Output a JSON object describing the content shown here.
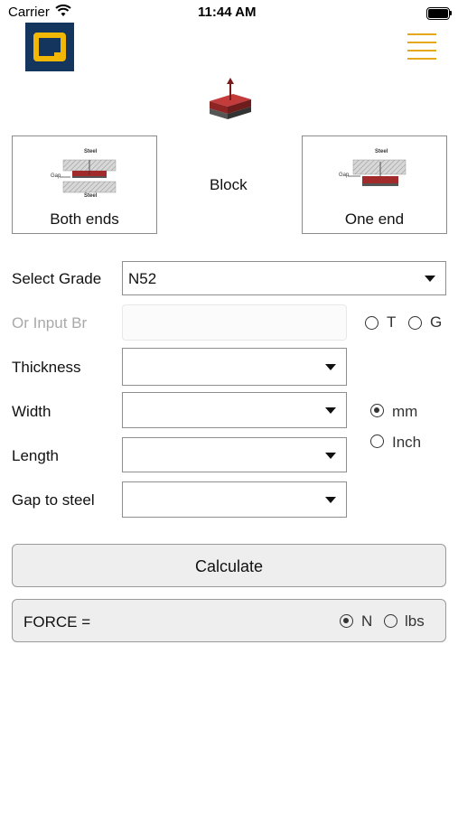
{
  "status_bar": {
    "carrier": "Carrier",
    "time": "11:44 AM"
  },
  "colors": {
    "accent": "#e5a81b",
    "logo_bg": "#14355e",
    "logo_ring": "#f2b705",
    "magnet_red": "#9b2a2a"
  },
  "shape": {
    "name": "Block",
    "icon": "block-magnet-icon"
  },
  "mounting": {
    "both": {
      "label": "Both ends",
      "top_tag": "Steel",
      "bottom_tag": "Steel",
      "gap_tag": "Gap"
    },
    "one": {
      "label": "One end",
      "top_tag": "Steel",
      "gap_tag": "Gap"
    }
  },
  "form": {
    "grade_label": "Select Grade",
    "grade_value": "N52",
    "br_label": "Or Input Br",
    "br_units": [
      "T",
      "G"
    ],
    "thickness_label": "Thickness",
    "width_label": "Width",
    "length_label": "Length",
    "gap_label": "Gap to steel",
    "dimension_units": {
      "mm": "mm",
      "inch": "Inch",
      "selected": "mm"
    }
  },
  "calculate_label": "Calculate",
  "result": {
    "label": "FORCE =",
    "value": "",
    "units": {
      "n": "N",
      "lbs": "lbs",
      "selected": "N"
    }
  }
}
